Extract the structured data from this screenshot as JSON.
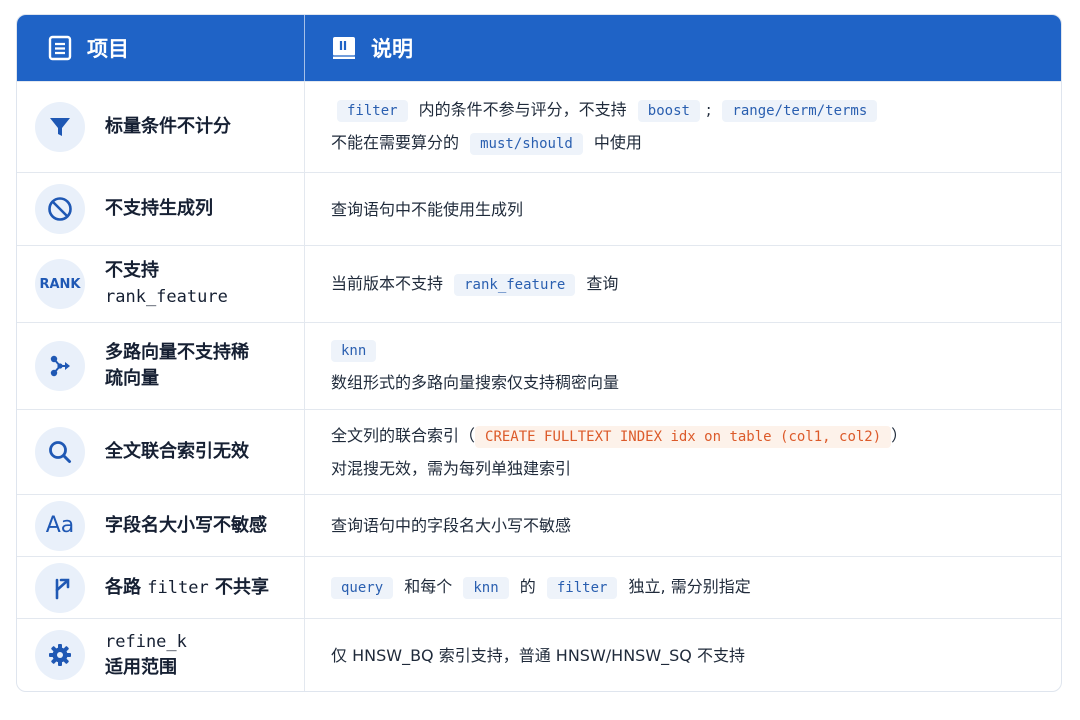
{
  "header": {
    "col_item": "项目",
    "col_desc": "说明"
  },
  "rows": [
    {
      "icon": "filter-icon",
      "title": "标量条件不计分",
      "desc_line1": {
        "code1": "filter",
        "text1": "内的条件不参与评分，不支持",
        "code2": "boost",
        "text2": ";",
        "code3": "range/term/terms"
      },
      "desc_line2": {
        "text1": "不能在需要算分的",
        "code1": "must/should",
        "text2": "中使用"
      }
    },
    {
      "icon": "ban-icon",
      "title": "不支持生成列",
      "desc": "查询语句中不能使用生成列"
    },
    {
      "icon_text": "RANK",
      "title_line1": "不支持",
      "title_line2": "rank_feature",
      "desc": {
        "text1": "当前版本不支持",
        "code": "rank_feature",
        "text2": "查询"
      }
    },
    {
      "icon": "vector-icon",
      "title_line1": "多路向量不支持稀",
      "title_line2": "疏向量",
      "desc_code": "knn",
      "desc_line2": "数组形式的多路向量搜索仅支持稠密向量"
    },
    {
      "icon": "search-icon",
      "title": "全文联合索引无效",
      "desc_line1": {
        "text1": "全文列的联合索引（",
        "code": "CREATE FULLTEXT INDEX idx on table (col1, col2)",
        "text2": "）"
      },
      "desc_line2": "对混搜无效，需为每列单独建索引"
    },
    {
      "icon_text": "Aa",
      "title": "字段名大小写不敏感",
      "desc": "查询语句中的字段名大小写不敏感"
    },
    {
      "icon": "branch-icon",
      "title_a": "各路",
      "title_code": "filter",
      "title_b": "不共享",
      "desc": {
        "code1": "query",
        "text1": "和每个",
        "code2": "knn",
        "text2": "的",
        "code3": "filter",
        "text3": "独立, 需分别指定"
      }
    },
    {
      "icon": "gear-icon",
      "title_line1": "refine_k",
      "title_line2": "适用范围",
      "desc": "仅 HNSW_BQ 索引支持，普通 HNSW/HNSW_SQ 不支持"
    }
  ],
  "colors": {
    "header_bg": "#1f63c6",
    "icon_bg": "#e9f0fa",
    "icon_fg": "#1f58b4",
    "code_fg": "#2a5fb0",
    "code_orange": "#dc5a2a"
  }
}
